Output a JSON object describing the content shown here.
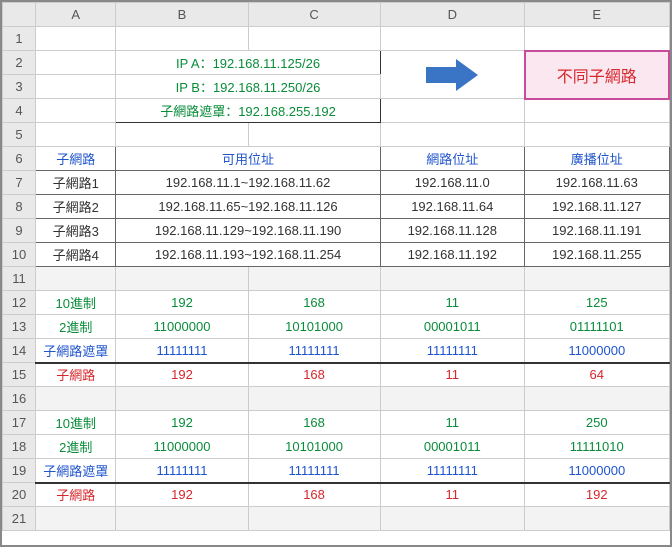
{
  "headers": {
    "cols": [
      "A",
      "B",
      "C",
      "D",
      "E"
    ],
    "rows": [
      "1",
      "2",
      "3",
      "4",
      "5",
      "6",
      "7",
      "8",
      "9",
      "10",
      "11",
      "12",
      "13",
      "14",
      "15",
      "16",
      "17",
      "18",
      "19",
      "20",
      "21"
    ]
  },
  "inputs": {
    "ipA": "IP A：192.168.11.125/26",
    "ipB": "IP B：192.168.11.250/26",
    "mask": "子網路遮罩：192.168.255.192"
  },
  "result": "不同子網路",
  "table": {
    "hdr": {
      "subnet": "子網路",
      "usable": "可用位址",
      "net": "網路位址",
      "bcast": "廣播位址"
    },
    "rows": [
      {
        "name": "子網路1",
        "usable": "192.168.11.1~192.168.11.62",
        "net": "192.168.11.0",
        "bcast": "192.168.11.63"
      },
      {
        "name": "子網路2",
        "usable": "192.168.11.65~192.168.11.126",
        "net": "192.168.11.64",
        "bcast": "192.168.11.127"
      },
      {
        "name": "子網路3",
        "usable": "192.168.11.129~192.168.11.190",
        "net": "192.168.11.128",
        "bcast": "192.168.11.191"
      },
      {
        "name": "子網路4",
        "usable": "192.168.11.193~192.168.11.254",
        "net": "192.168.11.192",
        "bcast": "192.168.11.255"
      }
    ]
  },
  "labels": {
    "dec": "10進制",
    "bin": "2進制",
    "mask": "子網路遮罩",
    "subnet": "子網路"
  },
  "calc1": {
    "dec": [
      "192",
      "168",
      "11",
      "125"
    ],
    "bin": [
      "11000000",
      "10101000",
      "00001011",
      "01111101"
    ],
    "mask": [
      "11111111",
      "11111111",
      "11111111",
      "11000000"
    ],
    "res": [
      "192",
      "168",
      "11",
      "64"
    ]
  },
  "calc2": {
    "dec": [
      "192",
      "168",
      "11",
      "250"
    ],
    "bin": [
      "11000000",
      "10101000",
      "00001011",
      "11111010"
    ],
    "mask": [
      "11111111",
      "11111111",
      "11111111",
      "11000000"
    ],
    "res": [
      "192",
      "168",
      "11",
      "192"
    ]
  }
}
